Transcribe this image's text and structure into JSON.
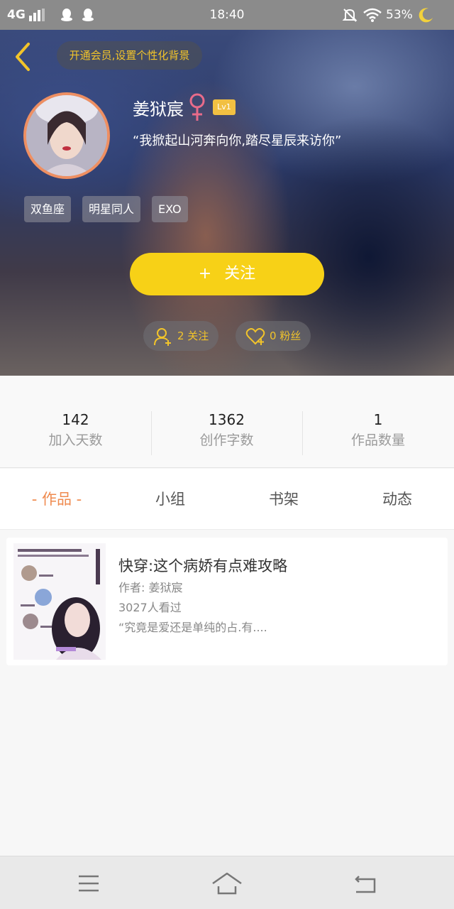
{
  "status_bar": {
    "network": "4G",
    "time": "18:40",
    "battery": "53%"
  },
  "header": {
    "vip_prompt": "开通会员,设置个性化背景",
    "username": "姜狱宸",
    "level": "Lv1",
    "signature": "“我掀起山河奔向你,踏尽星辰来访你”",
    "tags": [
      "双鱼座",
      "明星同人",
      "EXO"
    ],
    "follow_button": "关注",
    "follow_plus": "+",
    "following_count": "2 关注",
    "fans_count": "0 粉丝"
  },
  "stats": [
    {
      "value": "142",
      "label": "加入天数"
    },
    {
      "value": "1362",
      "label": "创作字数"
    },
    {
      "value": "1",
      "label": "作品数量"
    }
  ],
  "tabs": [
    "- 作品 -",
    "小组",
    "书架",
    "动态"
  ],
  "active_tab": 0,
  "works": [
    {
      "title": "快穿:这个病娇有点难攻略",
      "author": "作者: 姜狱宸",
      "views": "3027人看过",
      "excerpt": "“究竟是爱还是单纯的占.有...."
    }
  ],
  "colors": {
    "accent": "#f7d117",
    "tab_active": "#ef8a4e",
    "vip_text": "#f2c42a"
  },
  "icons": {
    "back": "chevron-left-icon",
    "gender": "female-icon",
    "following": "add-user-icon",
    "fans": "heart-plus-icon",
    "nav": [
      "menu-icon",
      "home-icon",
      "return-icon"
    ]
  }
}
